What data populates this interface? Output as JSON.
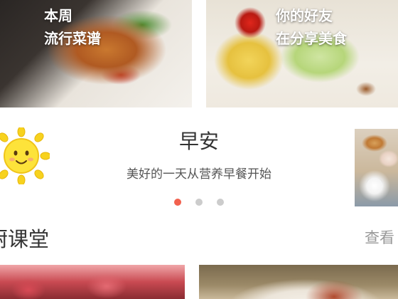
{
  "top_tiles": [
    {
      "line1": "本周",
      "line2": "流行菜谱"
    },
    {
      "line1": "你的好友",
      "line2": "在分享美食"
    }
  ],
  "banner": {
    "title": "早安",
    "subtitle": "美好的一天从营养早餐开始",
    "icon": "sun-icon",
    "slides_total": 3,
    "active_slide": 1
  },
  "section": {
    "title": "厨课堂",
    "view_more": "查看"
  },
  "colors": {
    "active_dot": "#f2614e",
    "inactive_dot": "#cccccc",
    "title_text": "#333333",
    "muted_text": "#999999"
  }
}
